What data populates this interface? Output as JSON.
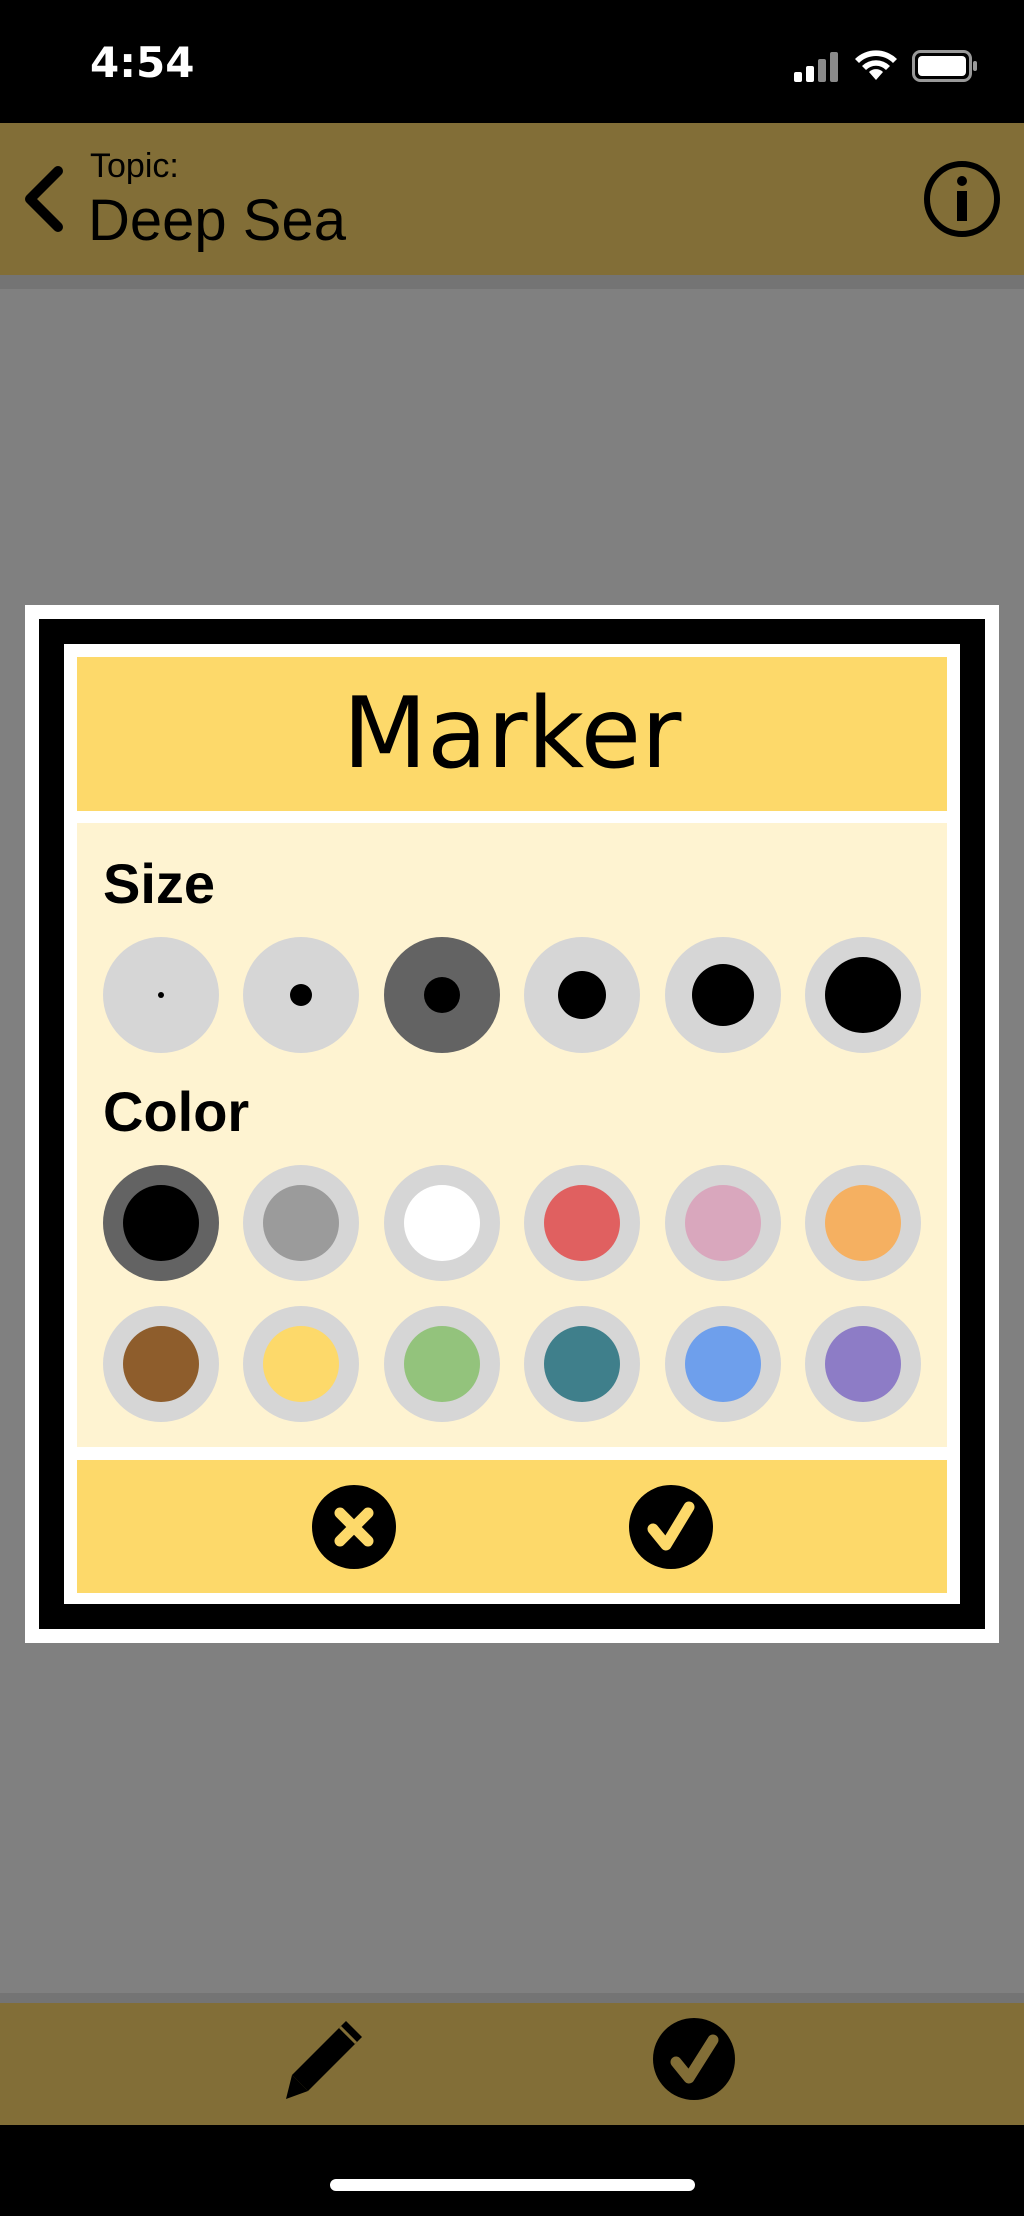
{
  "status_bar": {
    "time": "4:54"
  },
  "nav": {
    "topic_label": "Topic:",
    "topic_title": "Deep Sea"
  },
  "dialog": {
    "title": "Marker",
    "size_label": "Size",
    "color_label": "Color",
    "sizes": [
      {
        "name": "size-1",
        "selected": false
      },
      {
        "name": "size-2",
        "selected": false
      },
      {
        "name": "size-3",
        "selected": true
      },
      {
        "name": "size-4",
        "selected": false
      },
      {
        "name": "size-5",
        "selected": false
      },
      {
        "name": "size-6",
        "selected": false
      }
    ],
    "colors_row1": [
      {
        "name": "black",
        "hex": "#000000",
        "selected": true
      },
      {
        "name": "gray",
        "hex": "#9b9b9b",
        "selected": false
      },
      {
        "name": "white",
        "hex": "#ffffff",
        "selected": false
      },
      {
        "name": "red",
        "hex": "#e06060",
        "selected": false
      },
      {
        "name": "pink",
        "hex": "#d9a7bd",
        "selected": false
      },
      {
        "name": "orange",
        "hex": "#f5b061",
        "selected": false
      }
    ],
    "colors_row2": [
      {
        "name": "brown",
        "hex": "#8e5d2c",
        "selected": false
      },
      {
        "name": "yellow",
        "hex": "#fdd96a",
        "selected": false
      },
      {
        "name": "green",
        "hex": "#93c37c",
        "selected": false
      },
      {
        "name": "teal",
        "hex": "#3f7f8b",
        "selected": false
      },
      {
        "name": "blue",
        "hex": "#6e9fec",
        "selected": false
      },
      {
        "name": "purple",
        "hex": "#8d7cc6",
        "selected": false
      }
    ]
  },
  "colors": {
    "nav_bar": "#826e37",
    "accent_yellow": "#fdd96a",
    "dialog_body": "#fef3d1",
    "backdrop": "#808080"
  },
  "icons": {
    "back": "chevron-left-icon",
    "info": "info-icon",
    "cancel": "close-icon",
    "confirm": "checkmark-icon",
    "pencil": "pencil-icon",
    "done": "checkmark-icon"
  }
}
